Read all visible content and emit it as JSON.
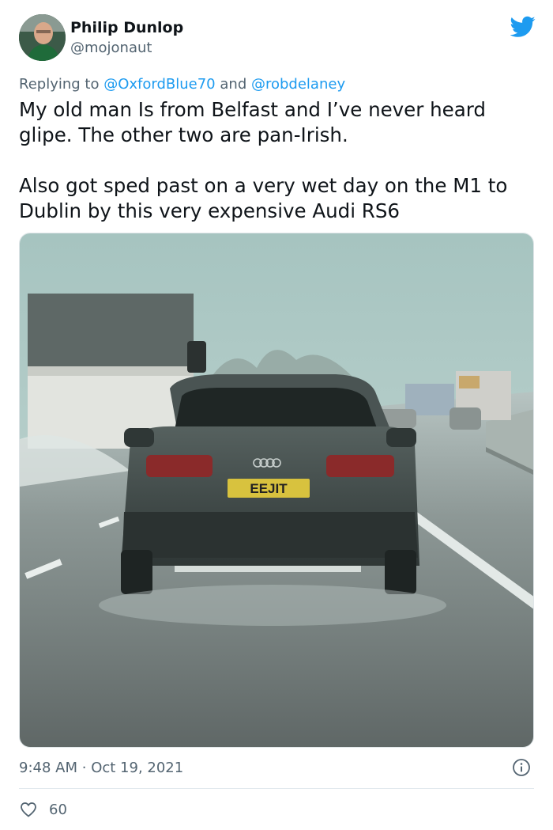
{
  "author": {
    "display_name": "Philip Dunlop",
    "handle": "@mojonaut"
  },
  "reply": {
    "prefix": "Replying to",
    "first_handle": "@OxfordBlue70",
    "joiner": "and",
    "second_handle": "@robdelaney"
  },
  "tweet": {
    "paragraph_1": "My old man Is from Belfast and I’ve never heard glipe. The other two are pan-Irish.",
    "paragraph_2": "Also got sped past on a very wet day on the M1 to Dublin by this very expensive Audi RS6"
  },
  "photo": {
    "plate_text": "EEJIT"
  },
  "meta": {
    "time": "9:48 AM",
    "separator": "·",
    "date": "Oct 19, 2021"
  },
  "engagement": {
    "likes": "60"
  },
  "colors": {
    "brand": "#1d9bf0",
    "text": "#0f1419",
    "muted": "#536471"
  },
  "icons": {
    "brand": "twitter-bird-icon",
    "info": "info-icon",
    "like": "heart-icon"
  }
}
